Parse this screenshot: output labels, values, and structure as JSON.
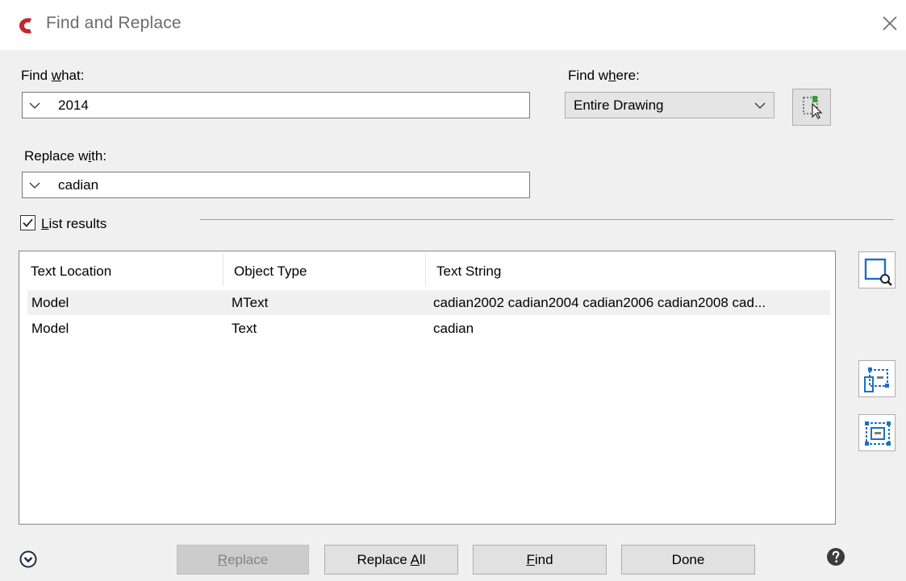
{
  "window": {
    "title": "Find and Replace",
    "icons": {
      "app": "cadian-logo-icon",
      "close": "close-icon"
    }
  },
  "find_what": {
    "label_pre": "Find ",
    "label_ul": "w",
    "label_post": "hat:",
    "value": "2014"
  },
  "find_where": {
    "label_pre": "Find w",
    "label_ul": "h",
    "label_post": "ere:",
    "selected": "Entire Drawing"
  },
  "replace_with": {
    "label_pre": "Replace w",
    "label_ul": "i",
    "label_post": "th:",
    "value": "cadian"
  },
  "list_results": {
    "checked": true,
    "label_ul": "L",
    "label_post": "ist results"
  },
  "results": {
    "columns": [
      "Text Location",
      "Object Type",
      "Text String"
    ],
    "rows": [
      {
        "location": "Model",
        "type": "MText",
        "text": "cadian2002 cadian2004 cadian2006 cadian2008 cad...",
        "selected": true
      },
      {
        "location": "Model",
        "type": "Text",
        "text": "cadian",
        "selected": false
      }
    ]
  },
  "side_icons": [
    "zoom-to-highlighted-icon",
    "create-selection-set-highlighted-icon",
    "create-selection-set-all-icon"
  ],
  "buttons": {
    "replace_ul": "R",
    "replace_post": "eplace",
    "replace_all_pre": "Replace ",
    "replace_all_ul": "A",
    "replace_all_post": "ll",
    "find_ul": "F",
    "find_post": "ind",
    "done": "Done"
  },
  "colors": {
    "logo": "#c0282d",
    "accent_blue": "#1e6fc0",
    "client_bg": "#f0f0f0"
  }
}
